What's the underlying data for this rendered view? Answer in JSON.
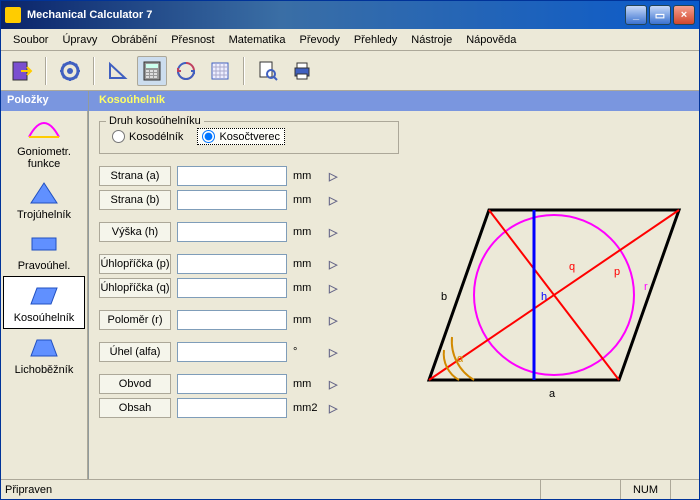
{
  "window": {
    "title": "Mechanical Calculator 7"
  },
  "menu": {
    "soubor": "Soubor",
    "upravy": "Úpravy",
    "obrabeni": "Obrábění",
    "presnost": "Přesnost",
    "matematika": "Matematika",
    "prevody": "Převody",
    "prehledy": "Přehledy",
    "nastroje": "Nástroje",
    "napoveda": "Nápověda"
  },
  "sidebar": {
    "header": "Položky",
    "items": [
      {
        "label": "Goniometr. funkce"
      },
      {
        "label": "Trojúhelník"
      },
      {
        "label": "Pravoúhel."
      },
      {
        "label": "Kosoúhelník"
      },
      {
        "label": "Lichoběžník"
      }
    ],
    "selected_index": 3
  },
  "main": {
    "title": "Kosoúhelník",
    "group_title": "Druh kosoúhelníku",
    "radio_kosodelnik": "Kosodélník",
    "radio_kosoctverec": "Kosočtverec",
    "radio_selected": "kosoctverec",
    "unit_mm": "mm",
    "unit_deg": "°",
    "unit_mm2": "mm2",
    "fields": {
      "strana_a": {
        "label": "Strana (a)",
        "value": ""
      },
      "strana_b": {
        "label": "Strana (b)",
        "value": ""
      },
      "vyska_h": {
        "label": "Výška (h)",
        "value": ""
      },
      "uhlop_p": {
        "label": "Úhlopříčka (p)",
        "value": ""
      },
      "uhlop_q": {
        "label": "Úhlopříčka (q)",
        "value": ""
      },
      "polomer_r": {
        "label": "Poloměr (r)",
        "value": ""
      },
      "uhel_alfa": {
        "label": "Úhel (alfa)",
        "value": ""
      },
      "obvod": {
        "label": "Obvod",
        "value": ""
      },
      "obsah": {
        "label": "Obsah",
        "value": ""
      }
    }
  },
  "diagram": {
    "labels": {
      "a": "a",
      "b": "b",
      "h": "h",
      "p": "p",
      "q": "q",
      "r": "r",
      "alpha": "α"
    },
    "colors": {
      "shape": "#000000",
      "circle": "#ff00ff",
      "p": "#ff0000",
      "q": "#ff0000",
      "h": "#0000ff",
      "alpha": "#d28a00",
      "r_label": "#ff00ff"
    }
  },
  "status": {
    "left": "Připraven",
    "num": "NUM"
  }
}
